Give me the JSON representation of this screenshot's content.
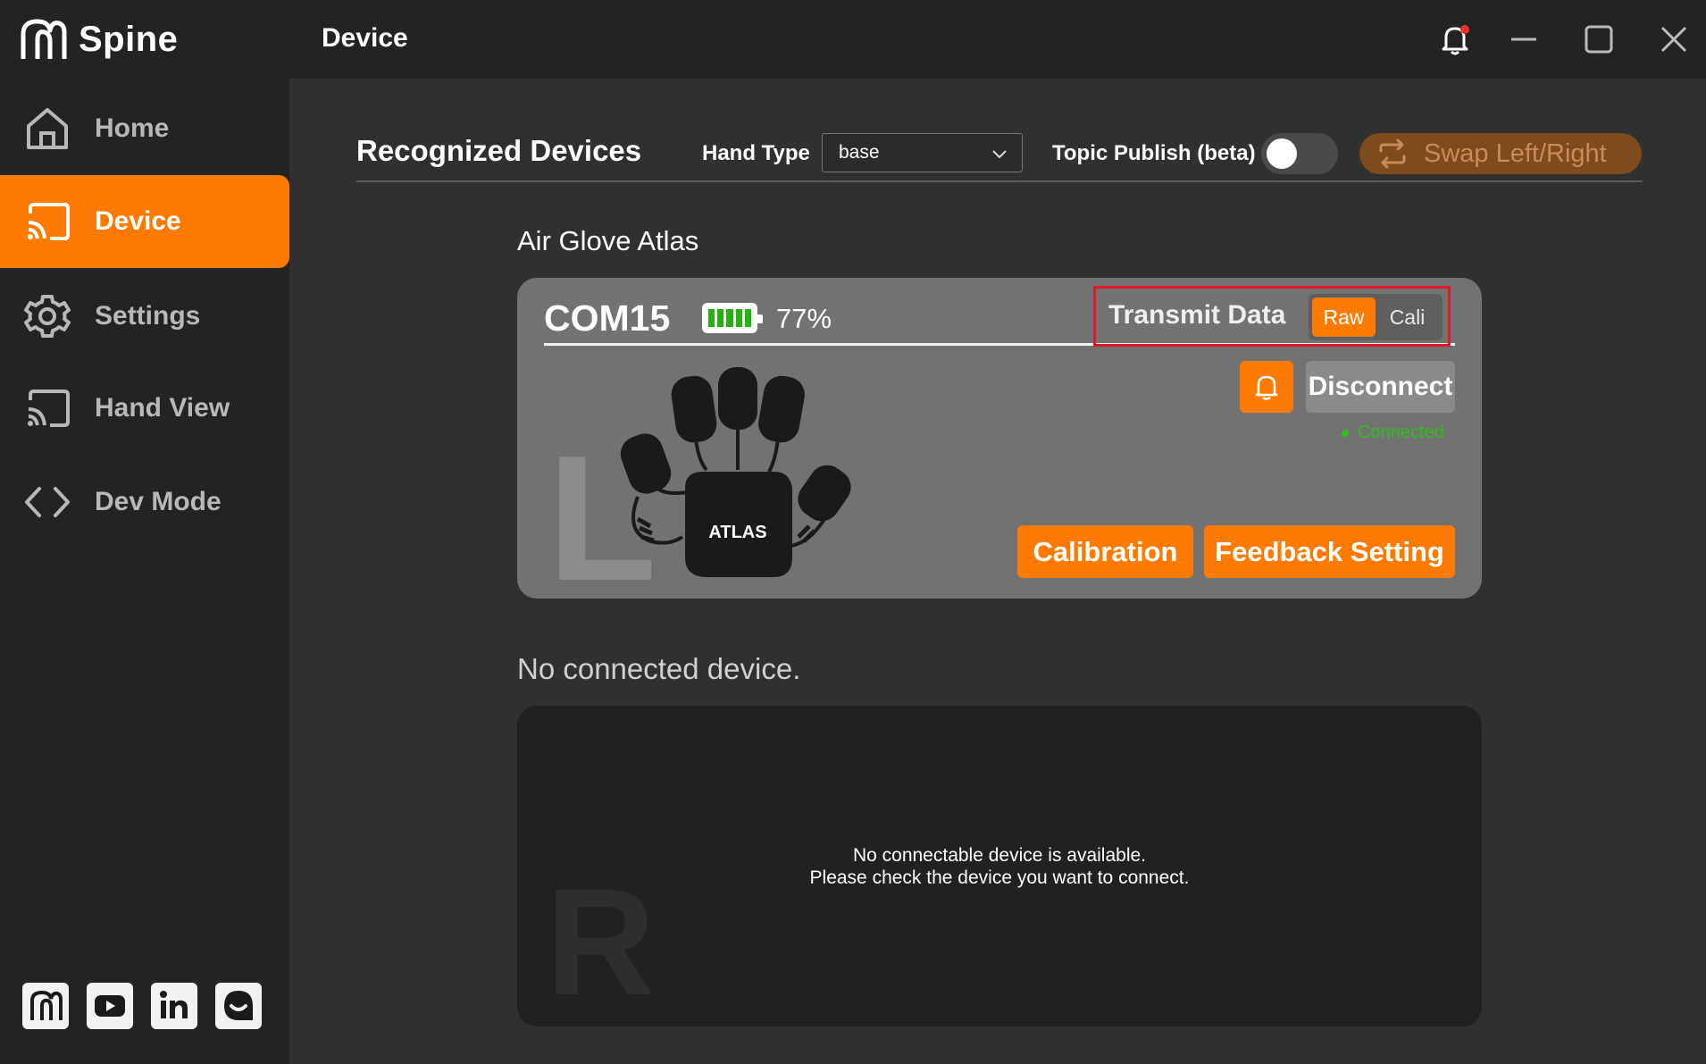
{
  "app": {
    "name": "Spine"
  },
  "sidebar": {
    "items": [
      {
        "label": "Home",
        "icon": "home-icon"
      },
      {
        "label": "Device",
        "icon": "cast-icon"
      },
      {
        "label": "Settings",
        "icon": "gear-icon"
      },
      {
        "label": "Hand View",
        "icon": "cast-icon"
      },
      {
        "label": "Dev Mode",
        "icon": "code-icon"
      }
    ],
    "active": "Device",
    "social": [
      "spine-logo-icon",
      "youtube-icon",
      "linkedin-icon",
      "chat-icon"
    ]
  },
  "titlebar": {
    "title": "Device"
  },
  "toolbar": {
    "section_title": "Recognized Devices",
    "hand_type_label": "Hand Type",
    "hand_type_value": "base",
    "topic_publish_label": "Topic Publish (beta)",
    "topic_publish_on": false,
    "swap_label": "Swap Left/Right"
  },
  "device_left": {
    "group_title": "Air Glove Atlas",
    "port": "COM15",
    "battery_pct": "77%",
    "battery_level": 0.77,
    "transmit_label": "Transmit Data",
    "transmit_modes": [
      "Raw",
      "Cali"
    ],
    "transmit_selected": "Raw",
    "disconnect_label": "Disconnect",
    "status": "Connected",
    "side_letter": "L",
    "device_brand": "ATLAS",
    "calibration_label": "Calibration",
    "feedback_label": "Feedback Setting"
  },
  "device_right": {
    "title": "No connected device.",
    "message_line1": "No connectable device is available.",
    "message_line2": "Please check the device you want to connect.",
    "side_letter": "R"
  },
  "colors": {
    "accent": "#ff7a00",
    "connected": "#2fbf1b",
    "highlight": "#e0192a"
  }
}
